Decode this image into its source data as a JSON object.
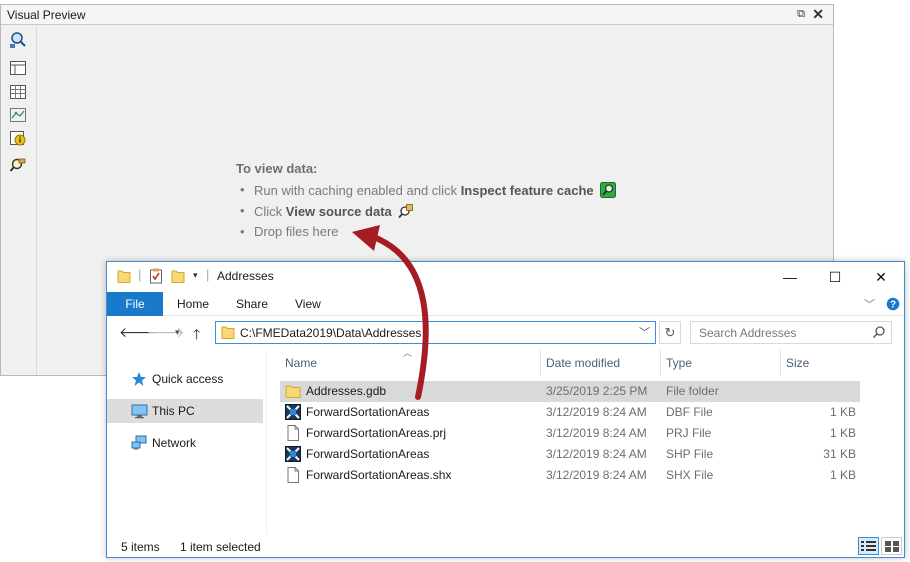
{
  "visual_preview": {
    "title": "Visual Preview",
    "restore_glyph": "⧉",
    "close_glyph": "✕",
    "tools": [
      "inspect-icon",
      "table-layout-icon",
      "grid-view-icon",
      "graphics-view-icon",
      "feature-info-icon",
      "view-source-icon"
    ],
    "hint": {
      "heading": "To view data:",
      "item1_text": "Run with caching enabled and click ",
      "item1_bold": "Inspect feature cache",
      "item2_text": "Click ",
      "item2_bold": "View source data",
      "item3_text": "Drop files here"
    }
  },
  "explorer": {
    "title": "Addresses",
    "window_buttons": {
      "minimize": "—",
      "maximize": "☐",
      "close": "✕"
    },
    "ribbon_tabs": [
      "File",
      "Home",
      "Share",
      "View"
    ],
    "address": "C:\\FMEData2019\\Data\\Addresses",
    "search_placeholder": "Search Addresses",
    "nav_pane": [
      "Quick access",
      "This PC",
      "Network"
    ],
    "columns": [
      "Name",
      "Date modified",
      "Type",
      "Size"
    ],
    "files": [
      {
        "name": "Addresses.gdb",
        "date": "3/25/2019 2:25 PM",
        "type": "File folder",
        "size": "",
        "icon": "folder-icon"
      },
      {
        "name": "ForwardSortationAreas",
        "date": "3/12/2019 8:24 AM",
        "type": "DBF File",
        "size": "1 KB",
        "icon": "fme-dataset-icon"
      },
      {
        "name": "ForwardSortationAreas.prj",
        "date": "3/12/2019 8:24 AM",
        "type": "PRJ File",
        "size": "1 KB",
        "icon": "file-icon"
      },
      {
        "name": "ForwardSortationAreas",
        "date": "3/12/2019 8:24 AM",
        "type": "SHP File",
        "size": "31 KB",
        "icon": "fme-dataset-icon"
      },
      {
        "name": "ForwardSortationAreas.shx",
        "date": "3/12/2019 8:24 AM",
        "type": "SHX File",
        "size": "1 KB",
        "icon": "file-icon"
      }
    ],
    "status": {
      "items": "5 items",
      "selected": "1 item selected"
    }
  },
  "colors": {
    "accent": "#1979ca",
    "arrow": "#a51c24",
    "selection": "#d9d9d9"
  }
}
